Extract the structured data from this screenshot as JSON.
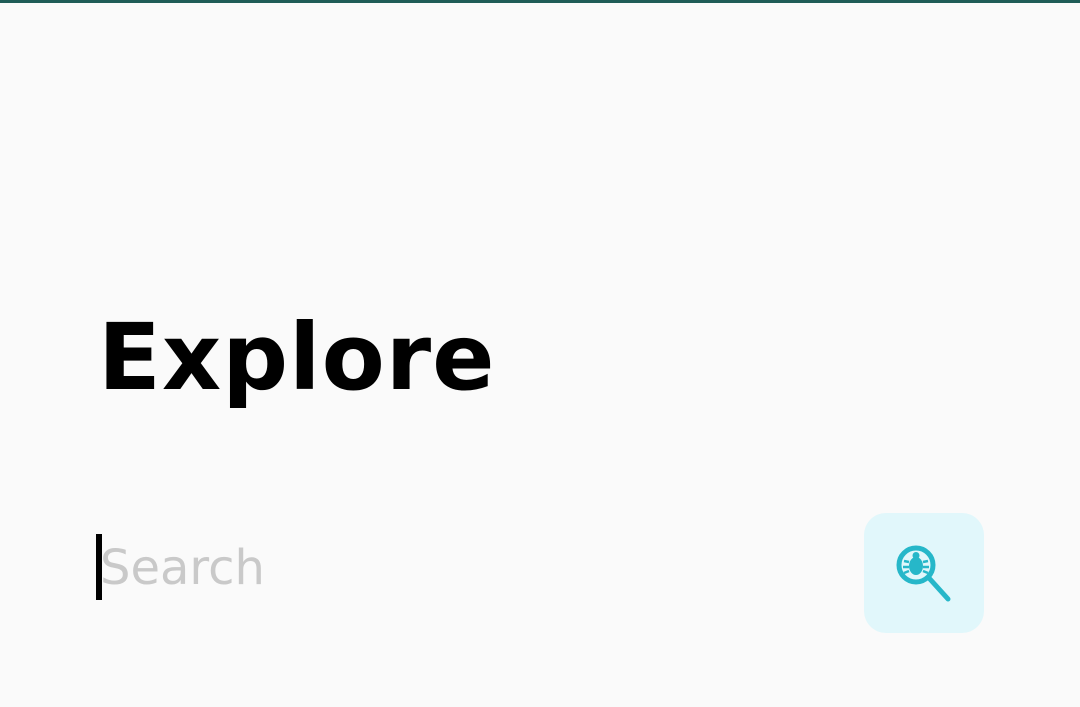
{
  "header": {
    "title": "Explore"
  },
  "search": {
    "placeholder": "Search",
    "value": "",
    "button_icon": "bug-search-icon"
  },
  "colors": {
    "background": "#fafafa",
    "status_line": "#1f5c57",
    "title_text": "#000000",
    "placeholder_text": "#c9c9c9",
    "button_background": "#e1f7fb",
    "icon_color": "#26b7c9"
  }
}
